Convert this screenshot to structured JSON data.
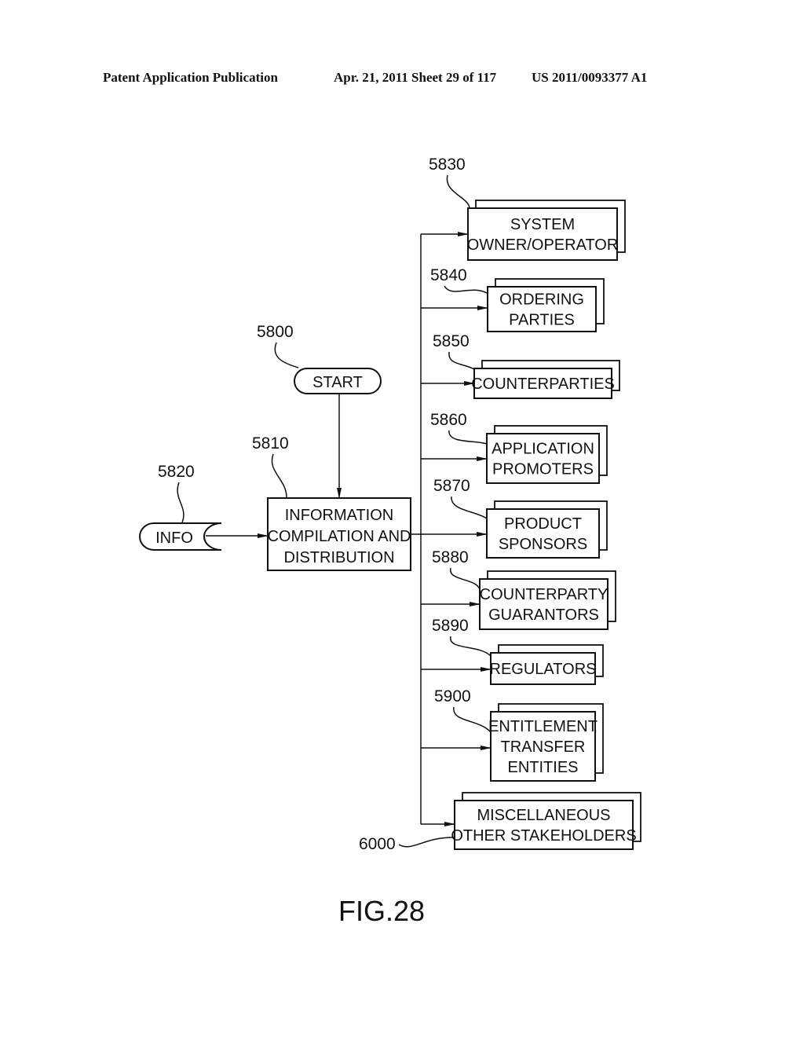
{
  "header": {
    "publication": "Patent Application Publication",
    "date_sheet": "Apr. 21, 2011  Sheet 29 of 117",
    "patent_number": "US 2011/0093377 A1"
  },
  "figure_label": "FIG.28",
  "start": {
    "ref": "5800",
    "label": "START"
  },
  "info": {
    "ref": "5820",
    "label": "INFO"
  },
  "center": {
    "ref": "5810",
    "lines": [
      "INFORMATION",
      "COMPILATION  AND",
      "DISTRIBUTION"
    ]
  },
  "targets": [
    {
      "ref": "5830",
      "lines": [
        "SYSTEM",
        "OWNER/OPERATOR"
      ]
    },
    {
      "ref": "5840",
      "lines": [
        "ORDERING",
        "PARTIES"
      ]
    },
    {
      "ref": "5850",
      "lines": [
        "COUNTERPARTIES"
      ]
    },
    {
      "ref": "5860",
      "lines": [
        "APPLICATION",
        "PROMOTERS"
      ]
    },
    {
      "ref": "5870",
      "lines": [
        "PRODUCT",
        "SPONSORS"
      ]
    },
    {
      "ref": "5880",
      "lines": [
        "COUNTERPARTY",
        "GUARANTORS"
      ]
    },
    {
      "ref": "5890",
      "lines": [
        "REGULATORS"
      ]
    },
    {
      "ref": "5900",
      "lines": [
        "ENTITLEMENT",
        "TRANSFER",
        "ENTITIES"
      ]
    },
    {
      "ref": "6000",
      "lines": [
        "MISCELLANEOUS",
        "OTHER  STAKEHOLDERS"
      ]
    }
  ]
}
